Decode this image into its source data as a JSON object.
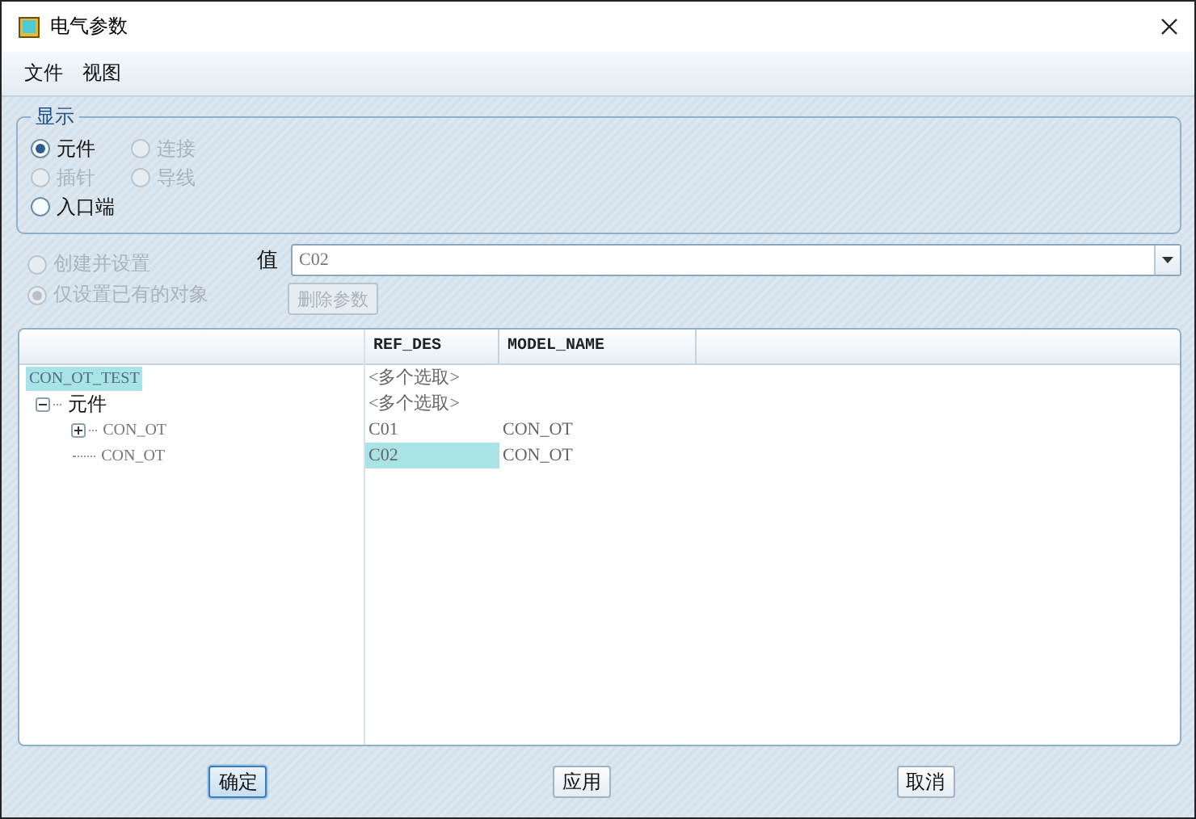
{
  "window": {
    "title": "电气参数"
  },
  "menu": [
    {
      "label": "文件"
    },
    {
      "label": "视图"
    }
  ],
  "display_group": {
    "title": "显示",
    "rows": [
      [
        {
          "label": "元件",
          "selected": true,
          "disabled": false
        },
        {
          "label": "连接",
          "selected": false,
          "disabled": true
        }
      ],
      [
        {
          "label": "插针",
          "selected": false,
          "disabled": true
        },
        {
          "label": "导线",
          "selected": false,
          "disabled": true
        }
      ],
      [
        {
          "label": "入口端",
          "selected": false,
          "disabled": false
        }
      ]
    ]
  },
  "mode_options": [
    {
      "label": "创建并设置",
      "selected": false,
      "disabled": true
    },
    {
      "label": "仅设置已有的对象",
      "selected": true,
      "disabled": true
    }
  ],
  "value_field": {
    "label": "值",
    "value": "C02"
  },
  "delete_button": {
    "label": "删除参数",
    "disabled": true
  },
  "tree": [
    {
      "label": "CON_OT_TEST",
      "selected": true,
      "children": [
        {
          "label": "元件",
          "selected": false,
          "expanded": true,
          "children": [
            {
              "label": "CON_OT",
              "selected": false,
              "expanded": false
            },
            {
              "label": "CON_OT",
              "selected": false
            }
          ]
        }
      ]
    }
  ],
  "table": {
    "columns": [
      "REF_DES",
      "MODEL_NAME"
    ],
    "rows": [
      {
        "cells": [
          {
            "text": "<多个选取>",
            "selected": false
          }
        ]
      },
      {
        "cells": [
          {
            "text": "<多个选取>",
            "selected": false
          }
        ]
      },
      {
        "cells": [
          {
            "text": "C01",
            "selected": false
          },
          {
            "text": "CON_OT",
            "selected": false
          }
        ]
      },
      {
        "cells": [
          {
            "text": "C02",
            "selected": true
          },
          {
            "text": "CON_OT",
            "selected": false
          }
        ]
      }
    ]
  },
  "buttons": [
    {
      "label": "确定",
      "default": true
    },
    {
      "label": "应用",
      "default": false
    },
    {
      "label": "取消",
      "default": false
    }
  ]
}
